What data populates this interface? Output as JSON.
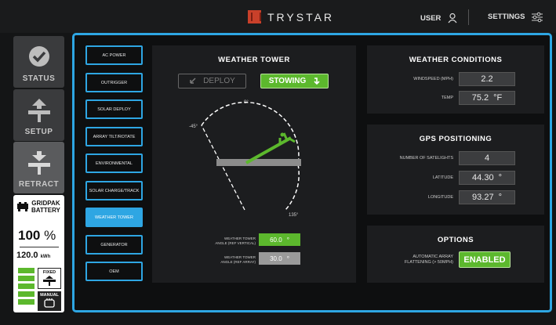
{
  "header": {
    "brand": "TRYSTAR",
    "user_label": "USER",
    "settings_label": "SETTINGS"
  },
  "nav": {
    "status": "STATUS",
    "setup": "SETUP",
    "retract": "RETRACT"
  },
  "battery": {
    "title_line1": "GRIDPAK",
    "title_line2": "BATTERY",
    "percent": "100",
    "percent_unit": "%",
    "energy": "120.0",
    "energy_unit": "kWh",
    "level_bars": 5,
    "fixed_label": "FIXED",
    "manual_label": "MANUAL"
  },
  "submenu": [
    "AC POWER",
    "OUTRIGGER",
    "SOLAR DEPLOY",
    "ARRAY TILT/ROTATE",
    "ENVIRONMENTAL",
    "SOLAR CHARGE/TRACK",
    "WEATHER TOWER",
    "GENERATOR",
    "OEM"
  ],
  "submenu_active": "WEATHER TOWER",
  "weather_tower": {
    "title": "WEATHER TOWER",
    "deploy_label": "DEPLOY",
    "stowing_label": "STOWING",
    "angle_0": "0°",
    "angle_neg45": "-45°",
    "angle_135": "135°",
    "vertical_label_line1": "WEATHER TOWER",
    "vertical_label_line2": "ANGLE (REF VERTICAL)",
    "vertical_value": "60.0",
    "vertical_unit": "°",
    "array_label_line1": "WEATHER TOWER",
    "array_label_line2": "ANGLE (REF ARRAY)",
    "array_value": "30.0",
    "array_unit": "°"
  },
  "weather_conditions": {
    "title": "WEATHER CONDITIONS",
    "windspeed_label": "WINDSPEED (MPH)",
    "windspeed_value": "2.2",
    "temp_label": "TEMP",
    "temp_value": "75.2",
    "temp_unit": "°F"
  },
  "gps": {
    "title": "GPS POSITIONING",
    "satellites_label": "NUMBER OF SATELIGHTS",
    "satellites_value": "4",
    "latitude_label": "LATITUDE",
    "latitude_value": "44.30",
    "latitude_unit": "°",
    "longitude_label": "LONGITUDE",
    "longitude_value": "93.27",
    "longitude_unit": "°"
  },
  "options": {
    "title": "OPTIONS",
    "flatten_label_line1": "AUTOMATIC ARRAY",
    "flatten_label_line2": "FLATTENING (> 50MPH)",
    "flatten_value": "ENABLED"
  },
  "colors": {
    "accent": "#2ea6e3",
    "active_green": "#5cb82d",
    "brand_red": "#c9402a"
  }
}
